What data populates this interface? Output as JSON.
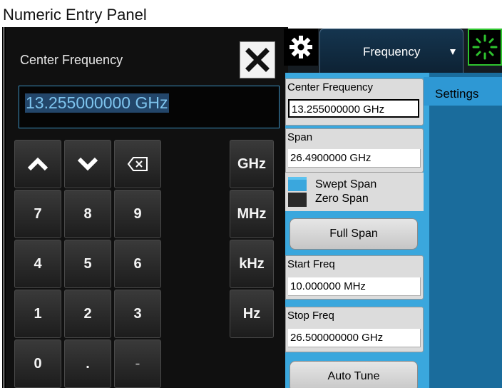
{
  "caption": "Numeric Entry Panel",
  "numpad": {
    "title": "Center Frequency",
    "value": "13.255000000 GHz",
    "keys": {
      "up": "^",
      "down": "v",
      "backspace": "backspace",
      "k7": "7",
      "k8": "8",
      "k9": "9",
      "k4": "4",
      "k5": "5",
      "k6": "6",
      "k1": "1",
      "k2": "2",
      "k3": "3",
      "k0": "0",
      "dot": ".",
      "minus": "-"
    },
    "units": [
      "GHz",
      "MHz",
      "kHz",
      "Hz"
    ]
  },
  "tab": {
    "label": "Frequency"
  },
  "settings_tab": {
    "label": "Settings"
  },
  "params": {
    "center": {
      "label": "Center Frequency",
      "value": "13.255000000 GHz"
    },
    "span": {
      "label": "Span",
      "value": "26.4900000 GHz"
    },
    "start": {
      "label": "Start Freq",
      "value": "10.000000 MHz"
    },
    "stop": {
      "label": "Stop Freq",
      "value": "26.500000000 GHz"
    }
  },
  "span_mode": {
    "options": [
      "Swept Span",
      "Zero Span"
    ],
    "selected": "Swept Span"
  },
  "buttons": {
    "full_span": "Full Span",
    "auto_tune": "Auto Tune"
  },
  "colors": {
    "accent": "#3aa7dd",
    "highlight": "#23466a",
    "status_green": "#2ec42e"
  }
}
